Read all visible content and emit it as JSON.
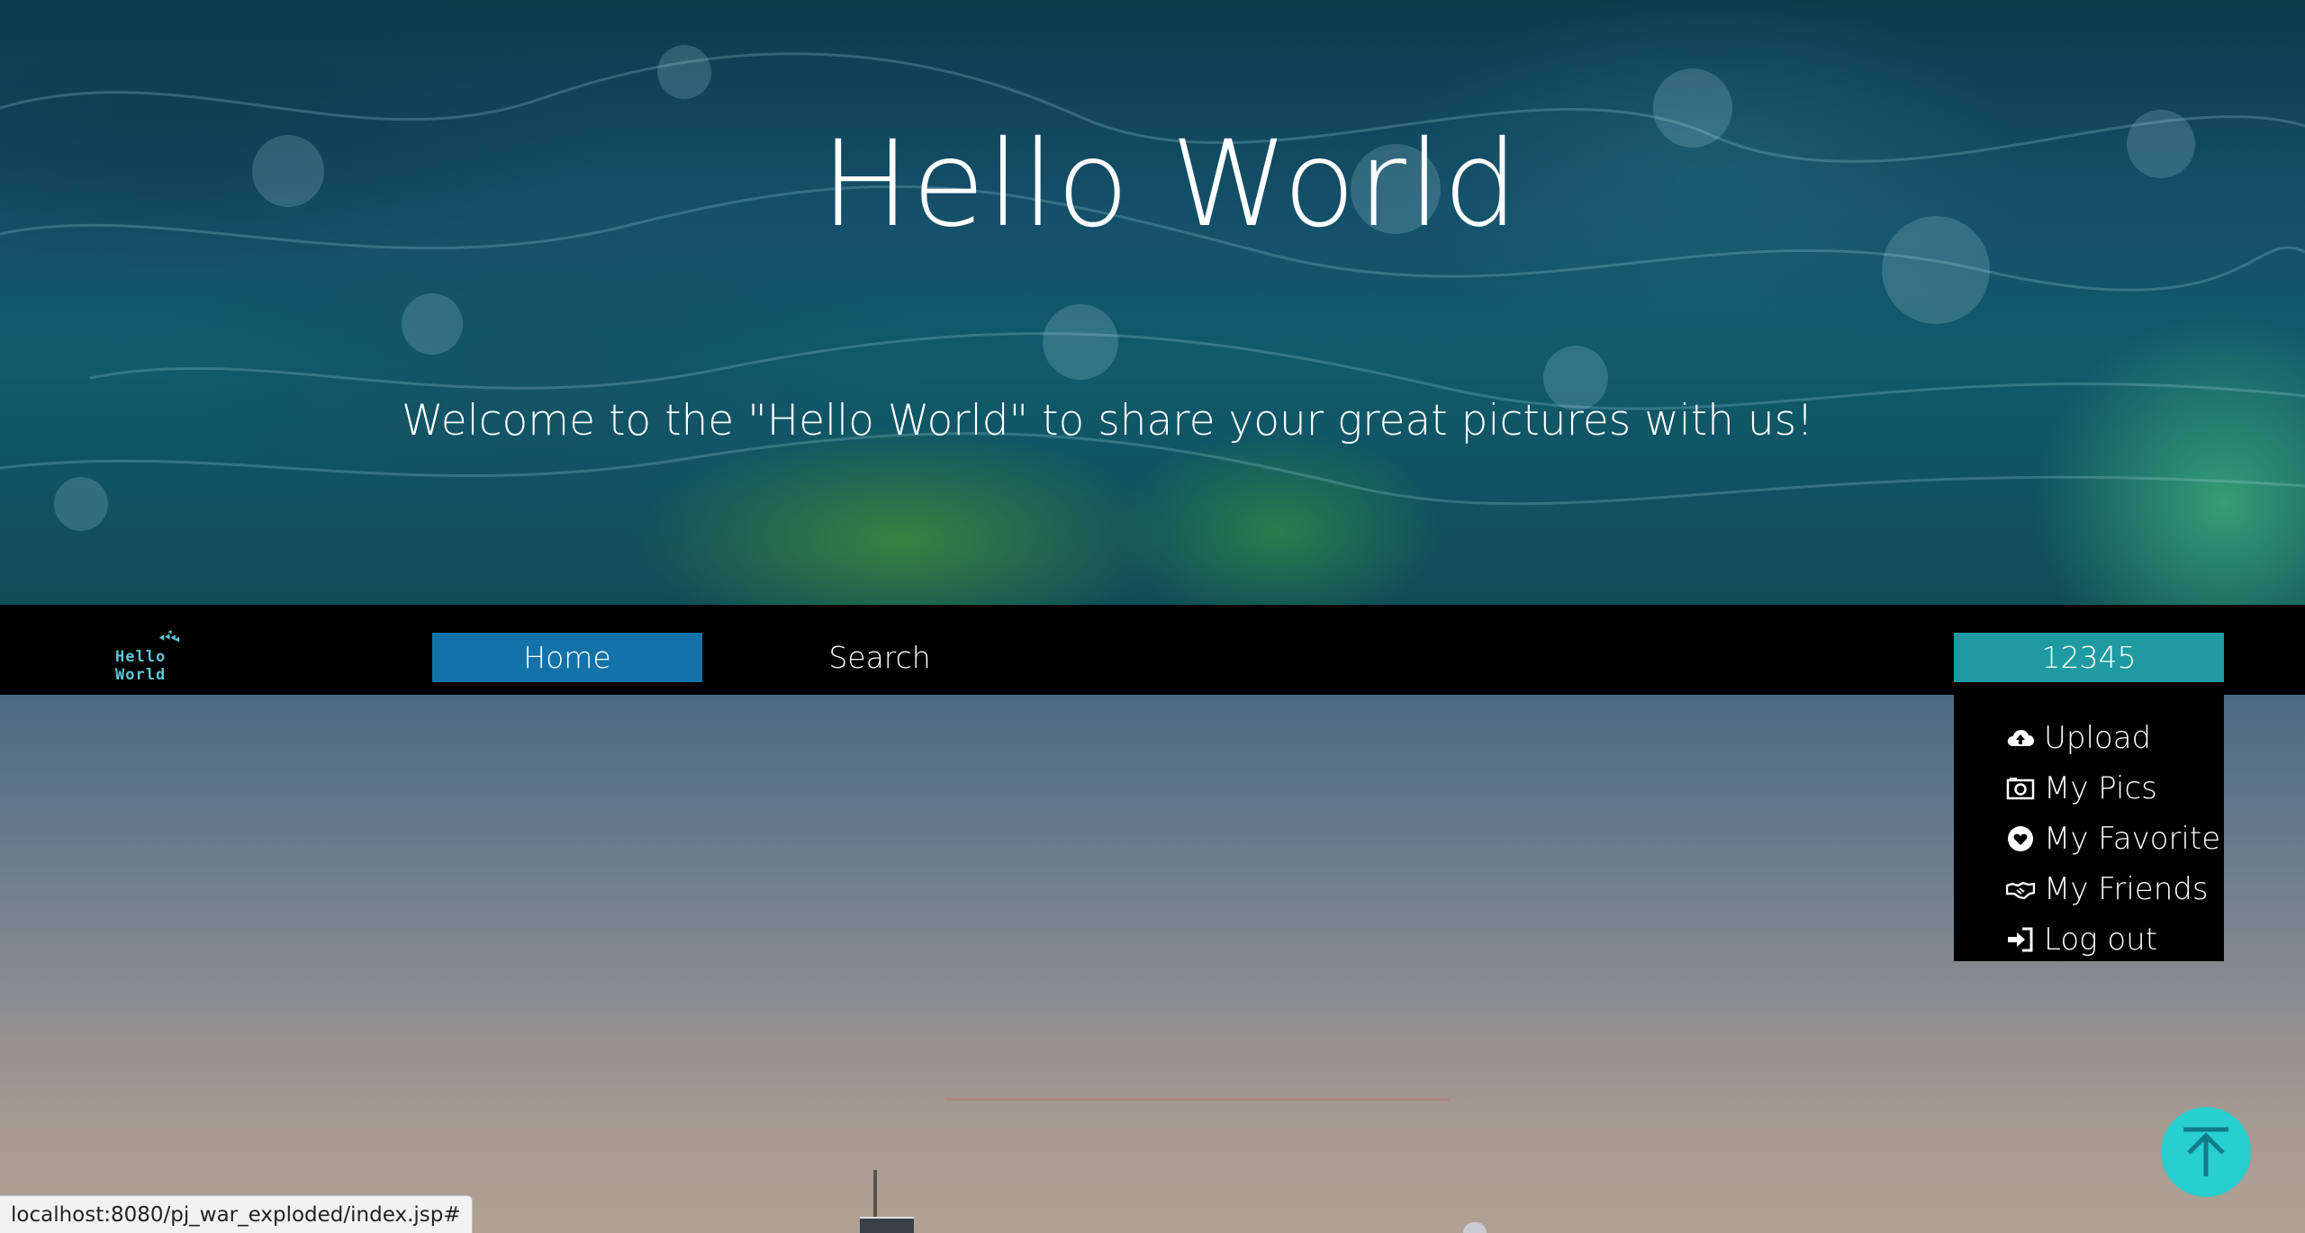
{
  "hero": {
    "title": "Hello World",
    "subtitle": "Welcome to the \"Hello World\" to share your great pictures with us!"
  },
  "nav": {
    "logo_text": "Hello World",
    "home_label": "Home",
    "search_label": "Search",
    "user_label": "12345"
  },
  "dropdown": {
    "items": [
      {
        "label": "Upload",
        "icon": "cloud-upload-icon"
      },
      {
        "label": "My Pics",
        "icon": "camera-icon"
      },
      {
        "label": "My Favorite",
        "icon": "heart-icon"
      },
      {
        "label": "My Friends",
        "icon": "handshake-icon"
      },
      {
        "label": "Log out",
        "icon": "sign-in-icon"
      }
    ]
  },
  "colors": {
    "nav_active": "#1373a8",
    "user_button": "#1e9aa0",
    "to_top": "#27cfcf"
  },
  "status_url": "localhost:8080/pj_war_exploded/index.jsp#"
}
